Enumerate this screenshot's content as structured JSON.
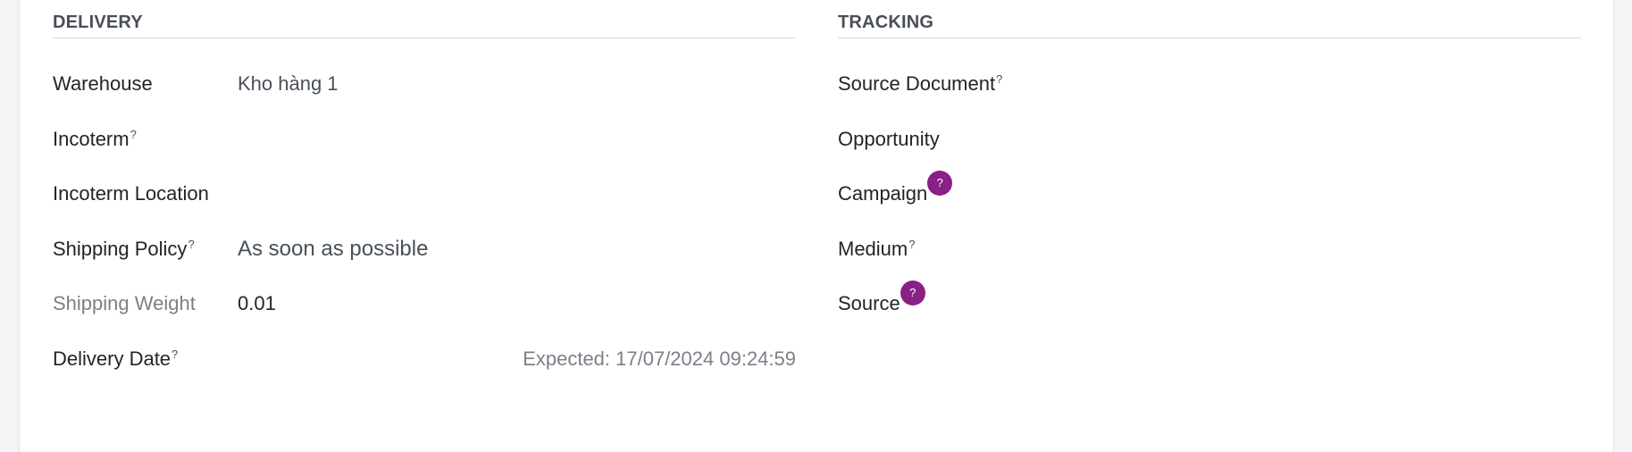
{
  "delivery": {
    "title": "DELIVERY",
    "fields": {
      "warehouse": {
        "label": "Warehouse",
        "value": "Kho hàng 1"
      },
      "incoterm": {
        "label": "Incoterm",
        "help": "?"
      },
      "incoterm_location": {
        "label": "Incoterm Location"
      },
      "shipping_policy": {
        "label": "Shipping Policy",
        "help": "?",
        "value": "As soon as possible"
      },
      "shipping_weight": {
        "label": "Shipping Weight",
        "value": "0.01"
      },
      "delivery_date": {
        "label": "Delivery Date",
        "help": "?",
        "expected": "Expected: 17/07/2024 09:24:59"
      }
    }
  },
  "tracking": {
    "title": "TRACKING",
    "fields": {
      "source_document": {
        "label": "Source Document",
        "help": "?"
      },
      "opportunity": {
        "label": "Opportunity"
      },
      "campaign": {
        "label": "Campaign",
        "help": "?"
      },
      "medium": {
        "label": "Medium",
        "help": "?"
      },
      "source": {
        "label": "Source",
        "help": "?"
      }
    }
  },
  "colors": {
    "help_badge": "#8a1f86",
    "label": "#212529",
    "muted_label": "#7b7f86",
    "value": "#495057"
  }
}
